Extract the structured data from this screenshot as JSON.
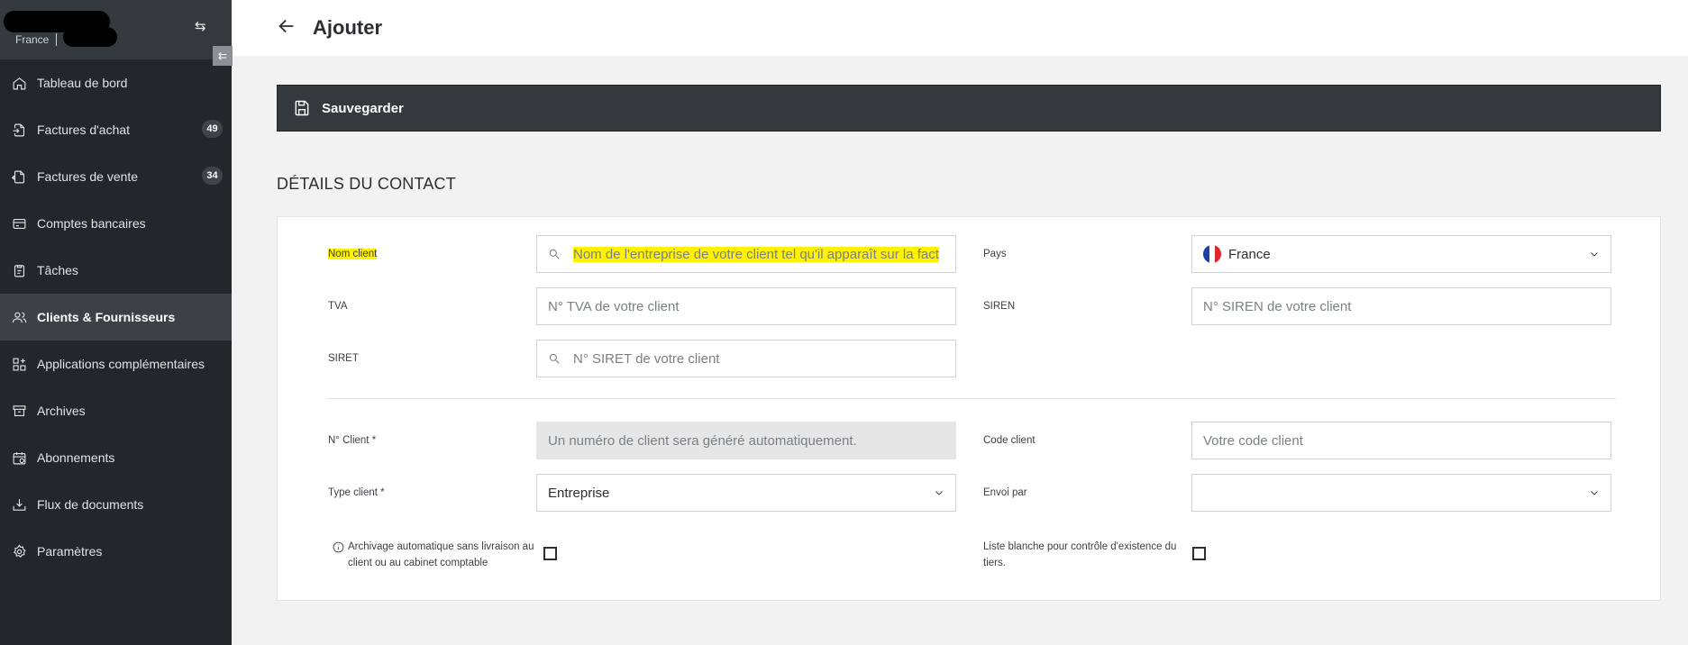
{
  "sidebar": {
    "country": "France",
    "items": [
      {
        "label": "Tableau de bord",
        "icon": "home-icon"
      },
      {
        "label": "Factures d'achat",
        "icon": "file-import-icon",
        "badge": "49"
      },
      {
        "label": "Factures de vente",
        "icon": "file-export-icon",
        "badge": "34"
      },
      {
        "label": "Comptes bancaires",
        "icon": "credit-card-icon"
      },
      {
        "label": "Tâches",
        "icon": "clipboard-icon"
      },
      {
        "label": "Clients & Fournisseurs",
        "icon": "users-icon",
        "active": true
      },
      {
        "label": "Applications complémentaires",
        "icon": "apps-icon"
      },
      {
        "label": "Archives",
        "icon": "archive-icon"
      },
      {
        "label": "Abonnements",
        "icon": "calendar-icon"
      },
      {
        "label": "Flux de documents",
        "icon": "download-tray-icon"
      },
      {
        "label": "Paramètres",
        "icon": "gear-icon"
      }
    ]
  },
  "header": {
    "title": "Ajouter"
  },
  "toolbar": {
    "save_label": "Sauvegarder"
  },
  "section": {
    "title": "DÉTAILS DU CONTACT"
  },
  "form": {
    "nom_client": {
      "label": "Nom client",
      "placeholder": "Nom de l'entreprise de votre client tel qu'il apparaît sur la fact"
    },
    "pays": {
      "label": "Pays",
      "value": "France"
    },
    "tva": {
      "label": "TVA",
      "placeholder": "N° TVA de votre client"
    },
    "siren": {
      "label": "SIREN",
      "placeholder": "N° SIREN de votre client"
    },
    "siret": {
      "label": "SIRET",
      "placeholder": "N° SIRET de votre client"
    },
    "num_client": {
      "label": "N° Client *",
      "placeholder": "Un numéro de client sera généré automatiquement."
    },
    "code_client": {
      "label": "Code client",
      "placeholder": "Votre code client"
    },
    "type_client": {
      "label": "Type client *",
      "value": "Entreprise"
    },
    "envoi_par": {
      "label": "Envoi par",
      "value": ""
    },
    "archivage": {
      "line1": "Archivage automatique sans livraison au",
      "line2": "client ou au cabinet comptable"
    },
    "liste_blanche": {
      "line1": "Liste blanche pour contrôle d'existence du",
      "line2": "tiers."
    }
  },
  "colors": {
    "sidebar_bg": "#23272b",
    "active_item": "#3b4146",
    "savebar": "#34393e",
    "highlight": "#fff200"
  }
}
